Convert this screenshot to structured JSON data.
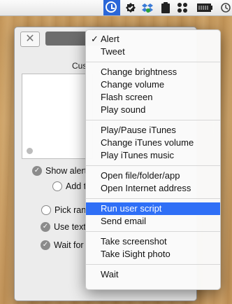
{
  "menubar": {
    "icons": [
      "clock-icon",
      "checkmark-badge-icon",
      "dropbox-icon",
      "clipboard-icon",
      "apps-grid-icon",
      "battery-icon",
      "time-machine-icon"
    ]
  },
  "window": {
    "close_label": "✕",
    "section_label": "Cus",
    "options": {
      "show_alert": "Show alert",
      "add": "Add t",
      "pick": "Pick ran",
      "use_text": "Use text",
      "wait_for": "Wait for"
    }
  },
  "menu": {
    "checkmark": "✓",
    "groups": [
      [
        "Alert",
        "Tweet"
      ],
      [
        "Change brightness",
        "Change volume",
        "Flash screen",
        "Play sound"
      ],
      [
        "Play/Pause iTunes",
        "Change iTunes volume",
        "Play iTunes music"
      ],
      [
        "Open file/folder/app",
        "Open Internet address"
      ],
      [
        "Run user script",
        "Send email"
      ],
      [
        "Take screenshot",
        "Take iSight photo"
      ],
      [
        "Wait"
      ]
    ],
    "selected": "Alert",
    "highlighted": "Run user script"
  },
  "colors": {
    "highlight": "#2f6ff6",
    "app_icon_bg": "#2b67d8"
  }
}
